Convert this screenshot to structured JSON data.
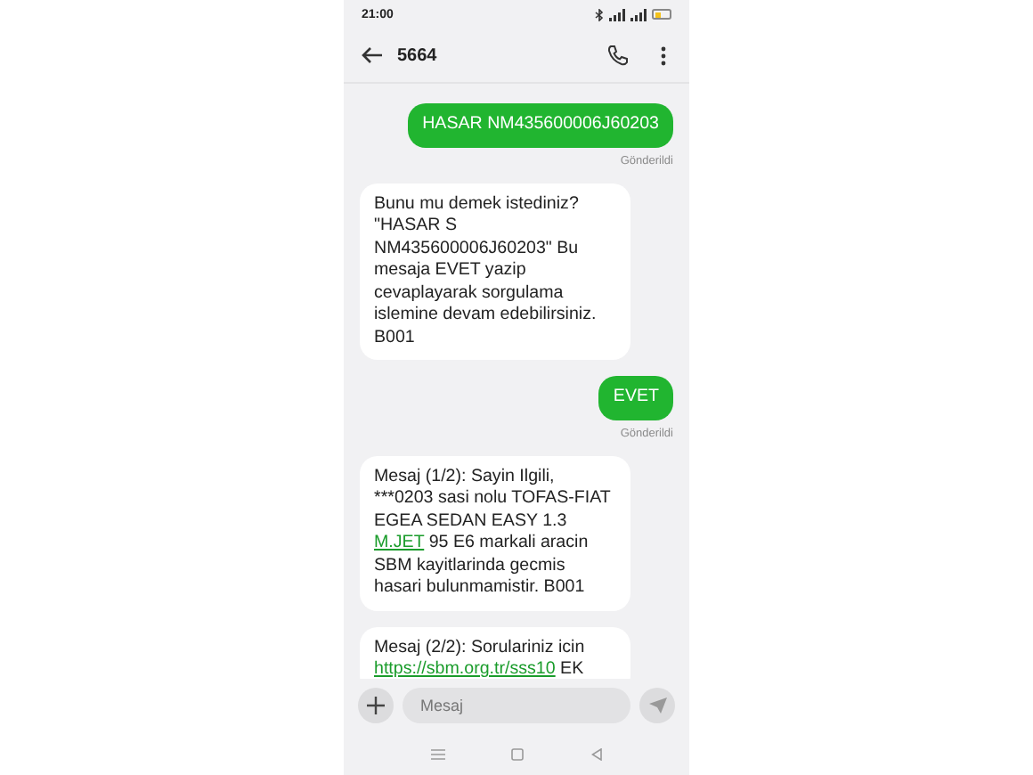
{
  "status_bar": {
    "time": "21:00"
  },
  "header": {
    "title": "5664"
  },
  "messages": [
    {
      "kind": "sent",
      "parts": [
        {
          "kind": "text",
          "text": "HASAR NM435600006J60203"
        }
      ],
      "status": "Gönderildi"
    },
    {
      "kind": "received",
      "parts": [
        {
          "kind": "text",
          "text": "Bunu mu demek istediniz? \"HASAR S NM435600006J60203\" Bu mesaja EVET yazip cevaplayarak sorgulama islemine devam edebilirsiniz. B001"
        }
      ]
    },
    {
      "kind": "sent",
      "parts": [
        {
          "kind": "text",
          "text": "EVET"
        }
      ],
      "status": "Gönderildi"
    },
    {
      "kind": "received",
      "parts": [
        {
          "kind": "text",
          "text": "Mesaj (1/2): Sayin Ilgili, ***0203 sasi nolu TOFAS-FIAT EGEA SEDAN EASY 1.3 "
        },
        {
          "kind": "link",
          "text": "M.JET"
        },
        {
          "kind": "text",
          "text": " 95 E6 markali aracin SBM kayitlarinda gecmis hasari bulunmamistir. B001"
        }
      ]
    },
    {
      "kind": "received",
      "parts": [
        {
          "kind": "text",
          "text": "Mesaj (2/2): Sorulariniz icin "
        },
        {
          "kind": "link",
          "text": "https://sbm.org.tr/sss10"
        },
        {
          "kind": "text",
          "text": " EK"
        }
      ]
    }
  ],
  "composer": {
    "placeholder": "Mesaj"
  }
}
